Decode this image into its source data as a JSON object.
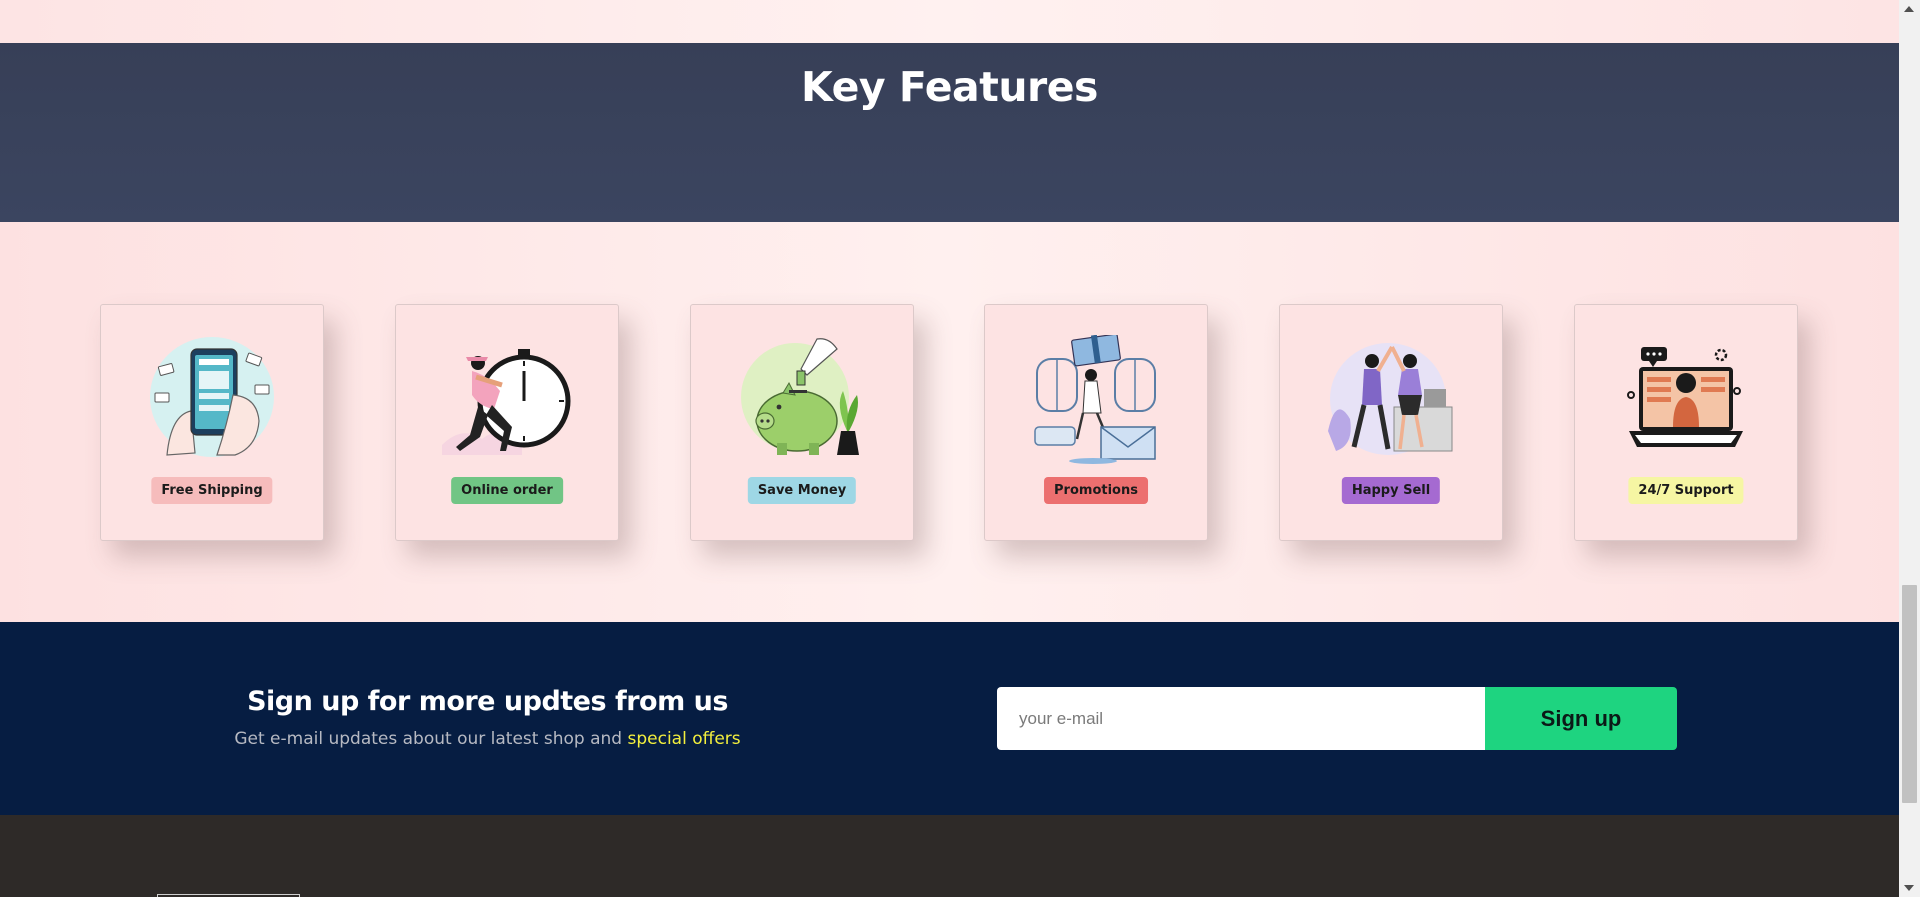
{
  "key_features": {
    "title": "Key Features",
    "items": [
      {
        "label": "Free Shipping",
        "badge_color": "#f6bcbc",
        "icon": "mobile-payment-illustration-icon"
      },
      {
        "label": "Online order",
        "badge_color": "#71c585",
        "icon": "stopwatch-delivery-illustration-icon"
      },
      {
        "label": "Save Money",
        "badge_color": "#9ed7e5",
        "icon": "piggy-bank-illustration-icon"
      },
      {
        "label": "Promotions",
        "badge_color": "#ec6f6f",
        "icon": "gift-envelope-illustration-icon"
      },
      {
        "label": "Happy Sell",
        "badge_color": "#a56ad1",
        "icon": "high-five-illustration-icon"
      },
      {
        "label": "24/7 Support",
        "badge_color": "#f6f6a3",
        "icon": "laptop-support-illustration-icon"
      }
    ]
  },
  "signup": {
    "title": "Sign up for more updtes from us",
    "subtitle_prefix": "Get e-mail updates about our latest shop and",
    "subtitle_highlight": "special offers",
    "email_placeholder": "your e-mail",
    "button_label": "Sign up"
  },
  "colors": {
    "key_band": "#373f57",
    "signup_band": "#061d42",
    "accent_green": "#1ed480",
    "highlight_yellow": "#f3ef3d",
    "footer": "#2e2a28"
  }
}
